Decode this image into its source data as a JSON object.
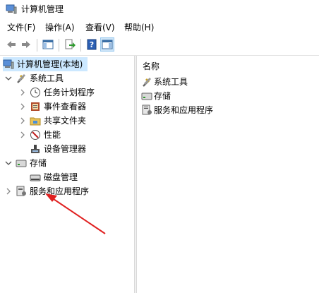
{
  "window": {
    "title": "计算机管理",
    "icon": "computer-management-icon"
  },
  "menu": [
    "文件(F)",
    "操作(A)",
    "查看(V)",
    "帮助(H)"
  ],
  "toolbar": [
    "back-arrow-icon",
    "forward-arrow-icon",
    "show-hide-tree-icon",
    "export-list-icon",
    "help-icon",
    "show-hide-action-pane-icon"
  ],
  "tree": {
    "root": "计算机管理(本地)",
    "system_tools": "系统工具",
    "task_scheduler": "任务计划程序",
    "event_viewer": "事件查看器",
    "shared_folders": "共享文件夹",
    "performance": "性能",
    "device_manager": "设备管理器",
    "storage": "存储",
    "disk_management": "磁盘管理",
    "services_apps": "服务和应用程序"
  },
  "list": {
    "column_name": "名称",
    "items": [
      "系统工具",
      "存储",
      "服务和应用程序"
    ]
  },
  "annotation": {
    "arrow_color": "#e02020"
  }
}
